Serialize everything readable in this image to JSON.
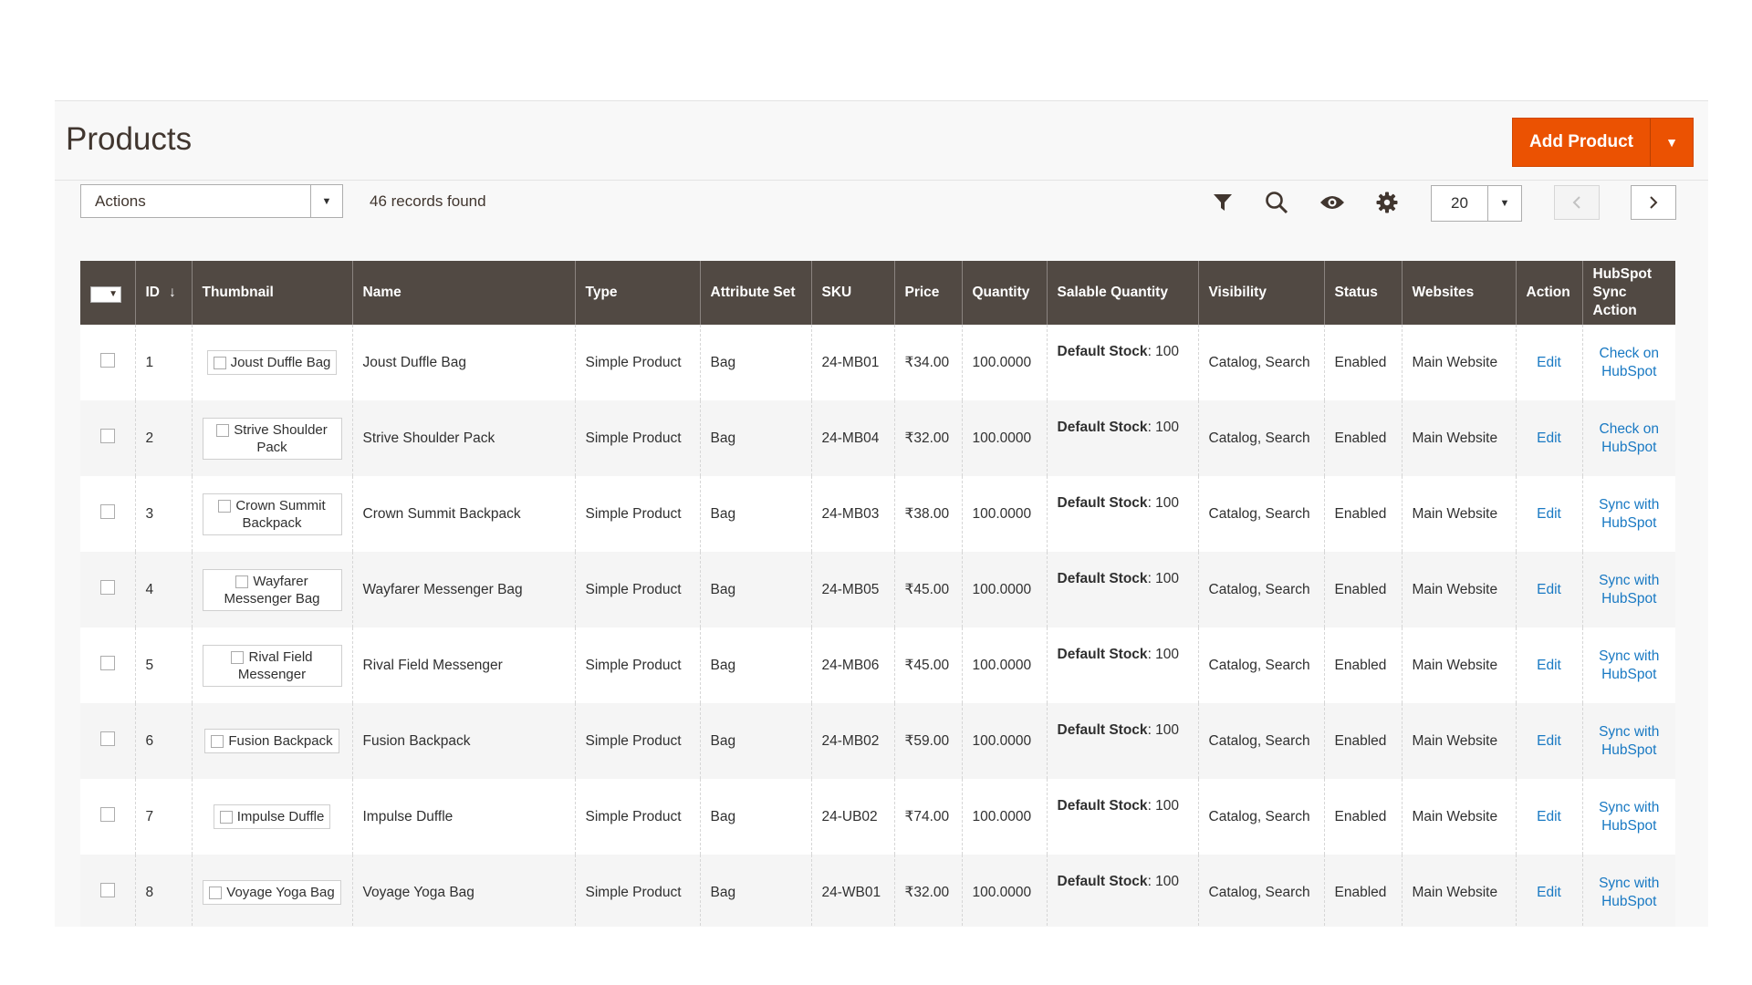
{
  "page": {
    "title": "Products",
    "add_button": "Add Product",
    "actions_value": "Actions",
    "records": "46 records found",
    "per_page": "20"
  },
  "icons": {
    "filter": "filter-icon",
    "search": "search-icon",
    "view": "eye-icon",
    "settings": "gear-icon",
    "prev": "chevron-left-icon",
    "next": "chevron-right-icon"
  },
  "colors": {
    "accent": "#eb5202",
    "header_bg": "#514943",
    "link": "#1979c3"
  },
  "columns": [
    "ID",
    "Thumbnail",
    "Name",
    "Type",
    "Attribute Set",
    "SKU",
    "Price",
    "Quantity",
    "Salable Quantity",
    "Visibility",
    "Status",
    "Websites",
    "Action",
    "HubSpot Sync Action"
  ],
  "rows": [
    {
      "id": "1",
      "thumb": "Joust Duffle Bag",
      "name": "Joust Duffle Bag",
      "type": "Simple Product",
      "attr": "Bag",
      "sku": "24-MB01",
      "price": "₹34.00",
      "qty": "100.0000",
      "stock_label": "Default Stock",
      "stock_value": ": 100",
      "visibility": "Catalog, Search",
      "status": "Enabled",
      "websites": "Main Website",
      "action": "Edit",
      "sync": "Check on HubSpot"
    },
    {
      "id": "2",
      "thumb": "Strive Shoulder Pack",
      "name": "Strive Shoulder Pack",
      "type": "Simple Product",
      "attr": "Bag",
      "sku": "24-MB04",
      "price": "₹32.00",
      "qty": "100.0000",
      "stock_label": "Default Stock",
      "stock_value": ": 100",
      "visibility": "Catalog, Search",
      "status": "Enabled",
      "websites": "Main Website",
      "action": "Edit",
      "sync": "Check on HubSpot"
    },
    {
      "id": "3",
      "thumb": "Crown Summit Backpack",
      "name": "Crown Summit Backpack",
      "type": "Simple Product",
      "attr": "Bag",
      "sku": "24-MB03",
      "price": "₹38.00",
      "qty": "100.0000",
      "stock_label": "Default Stock",
      "stock_value": ": 100",
      "visibility": "Catalog, Search",
      "status": "Enabled",
      "websites": "Main Website",
      "action": "Edit",
      "sync": "Sync with HubSpot"
    },
    {
      "id": "4",
      "thumb": "Wayfarer Messenger Bag",
      "name": "Wayfarer Messenger Bag",
      "type": "Simple Product",
      "attr": "Bag",
      "sku": "24-MB05",
      "price": "₹45.00",
      "qty": "100.0000",
      "stock_label": "Default Stock",
      "stock_value": ": 100",
      "visibility": "Catalog, Search",
      "status": "Enabled",
      "websites": "Main Website",
      "action": "Edit",
      "sync": "Sync with HubSpot"
    },
    {
      "id": "5",
      "thumb": "Rival Field Messenger",
      "name": "Rival Field Messenger",
      "type": "Simple Product",
      "attr": "Bag",
      "sku": "24-MB06",
      "price": "₹45.00",
      "qty": "100.0000",
      "stock_label": "Default Stock",
      "stock_value": ": 100",
      "visibility": "Catalog, Search",
      "status": "Enabled",
      "websites": "Main Website",
      "action": "Edit",
      "sync": "Sync with HubSpot"
    },
    {
      "id": "6",
      "thumb": "Fusion Backpack",
      "name": "Fusion Backpack",
      "type": "Simple Product",
      "attr": "Bag",
      "sku": "24-MB02",
      "price": "₹59.00",
      "qty": "100.0000",
      "stock_label": "Default Stock",
      "stock_value": ": 100",
      "visibility": "Catalog, Search",
      "status": "Enabled",
      "websites": "Main Website",
      "action": "Edit",
      "sync": "Sync with HubSpot"
    },
    {
      "id": "7",
      "thumb": "Impulse Duffle",
      "name": "Impulse Duffle",
      "type": "Simple Product",
      "attr": "Bag",
      "sku": "24-UB02",
      "price": "₹74.00",
      "qty": "100.0000",
      "stock_label": "Default Stock",
      "stock_value": ": 100",
      "visibility": "Catalog, Search",
      "status": "Enabled",
      "websites": "Main Website",
      "action": "Edit",
      "sync": "Sync with HubSpot"
    },
    {
      "id": "8",
      "thumb": "Voyage Yoga Bag",
      "name": "Voyage Yoga Bag",
      "type": "Simple Product",
      "attr": "Bag",
      "sku": "24-WB01",
      "price": "₹32.00",
      "qty": "100.0000",
      "stock_label": "Default Stock",
      "stock_value": ": 100",
      "visibility": "Catalog, Search",
      "status": "Enabled",
      "websites": "Main Website",
      "action": "Edit",
      "sync": "Sync with HubSpot"
    }
  ]
}
